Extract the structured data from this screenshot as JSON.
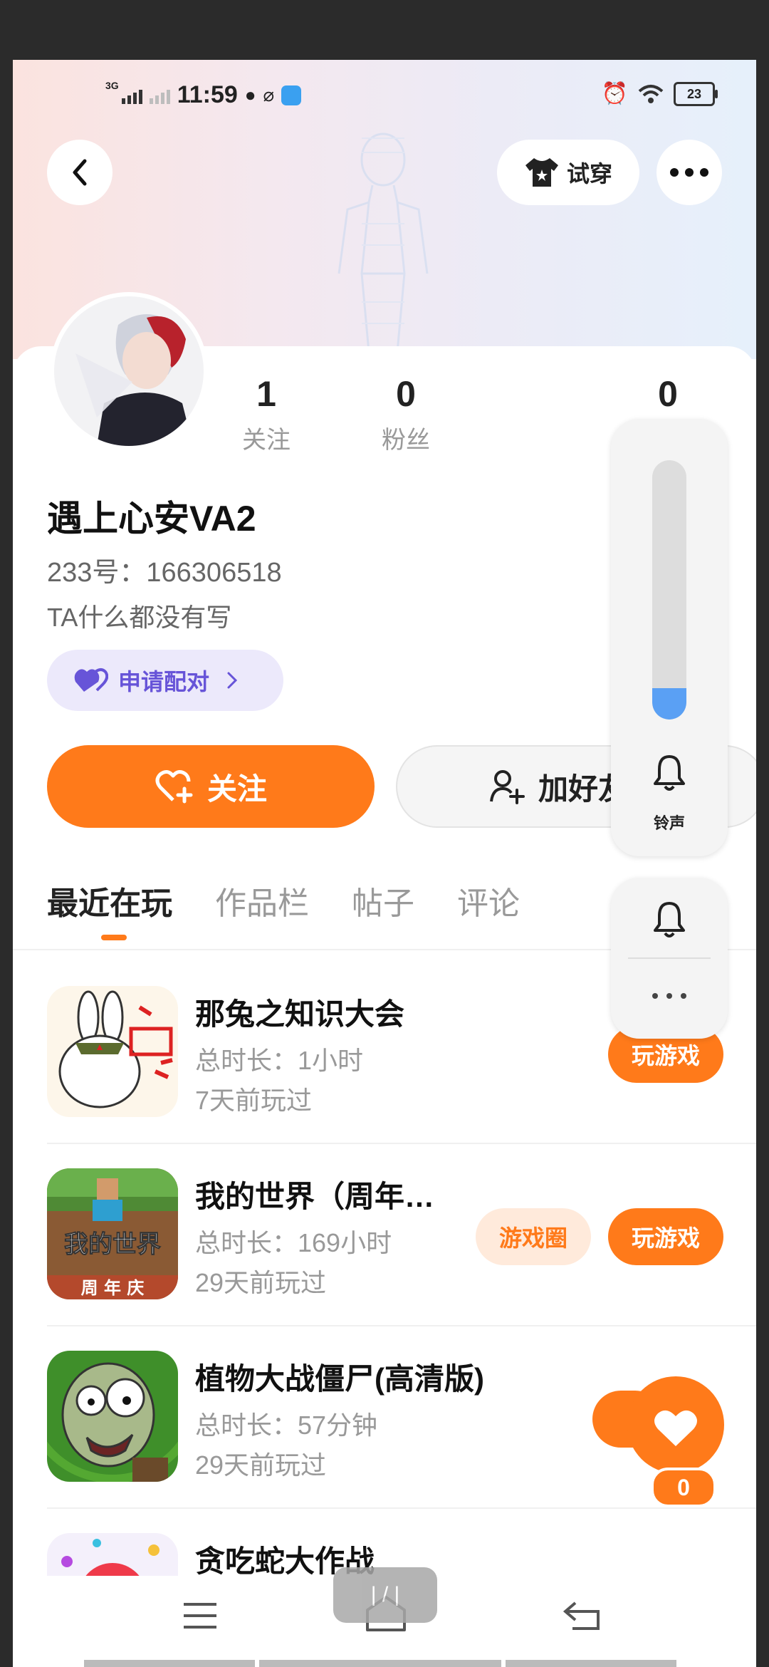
{
  "status_bar": {
    "network_label": "3G",
    "time": "11:59",
    "battery": "23"
  },
  "header": {
    "try_on_label": "试穿"
  },
  "profile": {
    "name": "遇上心安VA2",
    "uid": "233号：166306518",
    "bio": "TA什么都没有写",
    "pair_label": "申请配对",
    "stats": [
      {
        "value": "1",
        "label": "关注"
      },
      {
        "value": "0",
        "label": "粉丝"
      },
      {
        "value": "0",
        "label": ""
      }
    ],
    "follow_label": "关注",
    "add_friend_label": "加好友"
  },
  "tabs": [
    "最近在玩",
    "作品栏",
    "帖子",
    "评论"
  ],
  "games": [
    {
      "title": "那兔之知识大会",
      "duration": "总时长：1小时",
      "last_played": "7天前玩过",
      "play_label": "玩游戏",
      "circle_label": ""
    },
    {
      "title": "我的世界（周年…",
      "duration": "总时长：169小时",
      "last_played": "29天前玩过",
      "play_label": "玩游戏",
      "circle_label": "游戏圈"
    },
    {
      "title": "植物大战僵尸(高清版)",
      "duration": "总时长：57分钟",
      "last_played": "29天前玩过",
      "play_label": "",
      "circle_label": ""
    },
    {
      "title": "贪吃蛇大作战",
      "duration": "",
      "last_played": "",
      "play_label": "",
      "circle_label": ""
    }
  ],
  "volume_panel": {
    "label": "铃声",
    "level": 0.12
  },
  "like_fab": {
    "count": "0"
  },
  "nav": {
    "home_pill_label": "| / |"
  },
  "colors": {
    "accent": "#ff7a1a",
    "pair": "#6754d8",
    "volume": "#5aa0f4"
  }
}
